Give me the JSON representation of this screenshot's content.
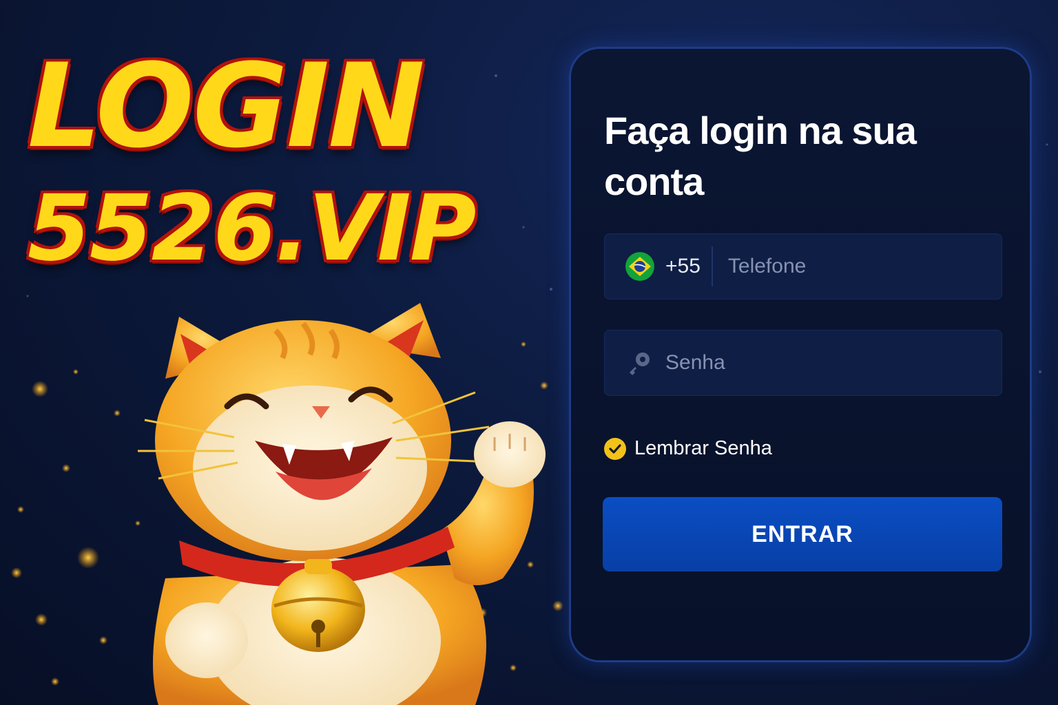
{
  "hero": {
    "line1": "LOGIN",
    "line2": "5526.VIP"
  },
  "login_card": {
    "title": "Faça login na sua conta",
    "phone": {
      "flag_icon": "brazil-flag-icon",
      "country_code": "+55",
      "placeholder": "Telefone"
    },
    "password": {
      "icon": "key-icon",
      "placeholder": "Senha"
    },
    "remember": {
      "checked": true,
      "label": "Lembrar Senha"
    },
    "submit_label": "ENTRAR"
  },
  "colors": {
    "background": "#0c1a3d",
    "hero_text": "#ffd81a",
    "hero_outline": "#b3120a",
    "card_border": "#1d3c86",
    "button": "#0a4ec3",
    "check": "#f2c21b"
  }
}
